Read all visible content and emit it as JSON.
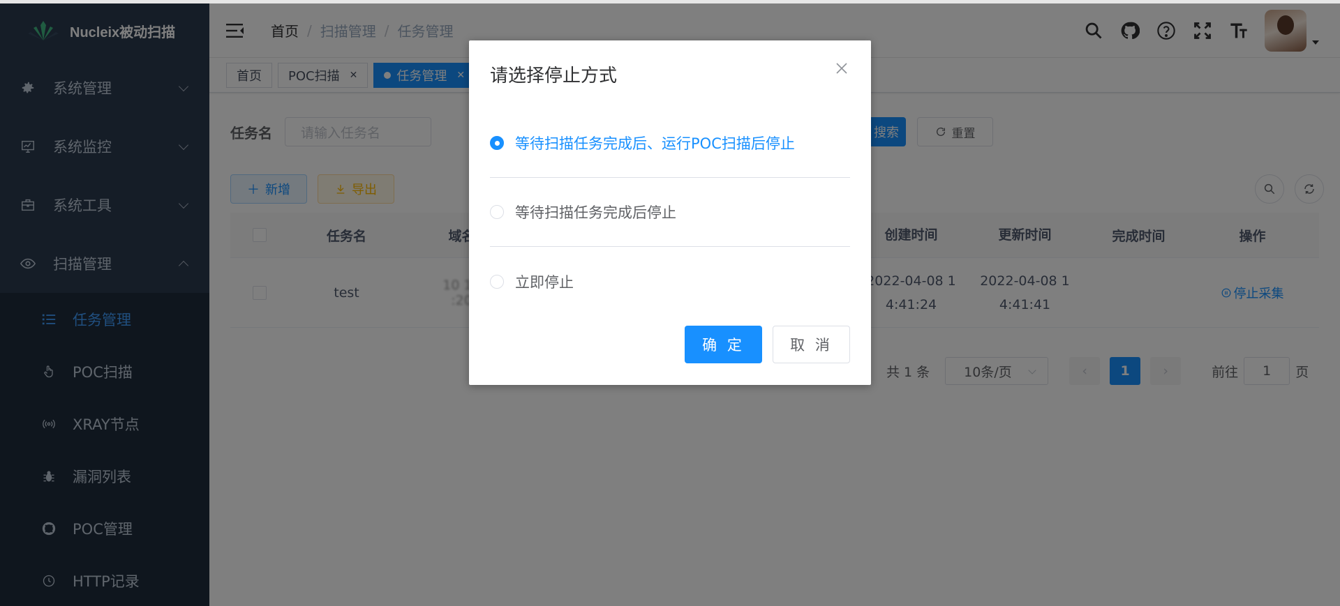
{
  "app": {
    "title": "Nucleix被动扫描"
  },
  "sidebar": {
    "items": [
      {
        "label": "系统管理",
        "icon": "gear-icon"
      },
      {
        "label": "系统监控",
        "icon": "monitor-icon"
      },
      {
        "label": "系统工具",
        "icon": "toolbox-icon"
      },
      {
        "label": "扫描管理",
        "icon": "eye-icon",
        "expanded": true
      }
    ],
    "subitems": [
      {
        "label": "任务管理",
        "icon": "list-icon",
        "active": true
      },
      {
        "label": "POC扫描",
        "icon": "hand-pointer-icon"
      },
      {
        "label": "XRAY节点",
        "icon": "wireless-icon"
      },
      {
        "label": "漏洞列表",
        "icon": "bug-icon"
      },
      {
        "label": "POC管理",
        "icon": "lifebuoy-icon"
      },
      {
        "label": "HTTP记录",
        "icon": "clock-icon"
      }
    ]
  },
  "breadcrumb": [
    "首页",
    "扫描管理",
    "任务管理"
  ],
  "tags": [
    {
      "label": "首页"
    },
    {
      "label": "POC扫描"
    },
    {
      "label": "任务管理",
      "active": true
    }
  ],
  "search": {
    "label": "任务名",
    "placeholder": "请输入任务名",
    "search_button": "搜索",
    "search_button_visible": "搜索",
    "reset_button": "重置"
  },
  "toolbar": {
    "add": "新增",
    "export": "导出"
  },
  "table": {
    "headers": {
      "name": "任务名",
      "domain": "域名",
      "created": "创建时间",
      "updated": "更新时间",
      "done": "完成时间",
      "op": "操作"
    },
    "rows": [
      {
        "name": "test",
        "domain_line1": "10 1 .",
        "domain_line2": ":20",
        "created_line1": "2022-04-08 1",
        "created_line2": "4:41:24",
        "updated_line1": "2022-04-08 1",
        "updated_line2": "4:41:41",
        "done": "",
        "op": "停止采集"
      }
    ]
  },
  "pagination": {
    "total": "共 1 条",
    "page_size": "10条/页",
    "current_page": "1",
    "goto_label": "前往",
    "goto_value": "1",
    "page_suffix": "页"
  },
  "dialog": {
    "title": "请选择停止方式",
    "options": [
      {
        "label": "等待扫描任务完成后、运行POC扫描后停止",
        "selected": true
      },
      {
        "label": "等待扫描任务完成后停止",
        "selected": false
      },
      {
        "label": "立即停止",
        "selected": false
      }
    ],
    "confirm": "确 定",
    "cancel": "取 消"
  },
  "colors": {
    "primary": "#1890ff",
    "sidebar_bg": "#2b3a4e",
    "submenu_bg": "#1f2d3d",
    "warning": "#ffba00"
  }
}
